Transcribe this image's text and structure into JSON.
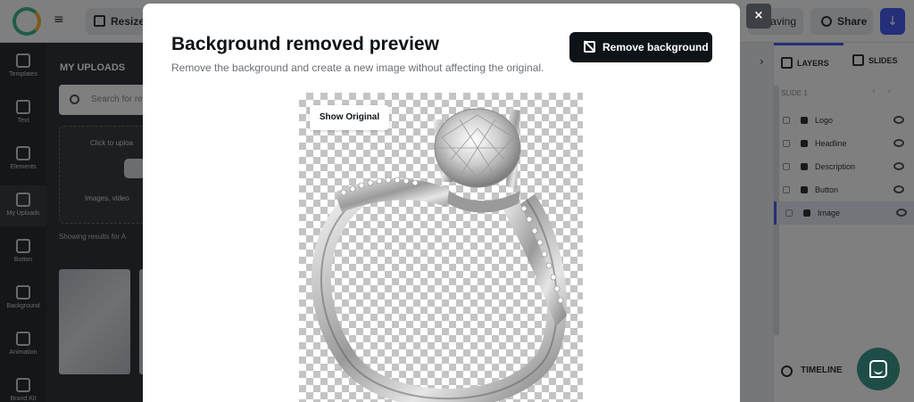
{
  "app": {
    "resize_label": "Resize",
    "saving_label": "Saving",
    "share_label": "Share",
    "download_icon": "download-icon",
    "menu_icon": "hamburger-icon"
  },
  "sidebar": {
    "items": [
      {
        "label": "Templates",
        "icon": "templates-icon"
      },
      {
        "label": "Text",
        "icon": "text-icon"
      },
      {
        "label": "Elements",
        "icon": "elements-icon"
      },
      {
        "label": "My Uploads",
        "icon": "uploads-icon"
      },
      {
        "label": "Button",
        "icon": "button-icon"
      },
      {
        "label": "Background",
        "icon": "background-icon"
      },
      {
        "label": "Animation",
        "icon": "animation-icon"
      },
      {
        "label": "Brand Kit",
        "icon": "brand-kit-icon"
      }
    ]
  },
  "uploads_panel": {
    "title": "MY UPLOADS",
    "search_placeholder": "Search for re",
    "upload_prompt": "Click to uploa",
    "upload_hint": "Images, video",
    "showing_text": "Showing results for A"
  },
  "right_panel": {
    "tabs": [
      "LAYERS",
      "SLIDES"
    ],
    "slide_label": "SLIDE 1",
    "layers": [
      "Logo",
      "Headline",
      "Description",
      "Button",
      "Image"
    ],
    "timeline_label": "TIMELINE"
  },
  "modal": {
    "title": "Background removed preview",
    "subtitle": "Remove the background and create a new image without affecting the original.",
    "remove_button": "Remove background",
    "show_original": "Show Original",
    "close_label": "×"
  },
  "colors": {
    "accent": "#4b5cf0",
    "button_dark": "#0e1318",
    "chat_bubble": "#1e4d47"
  }
}
